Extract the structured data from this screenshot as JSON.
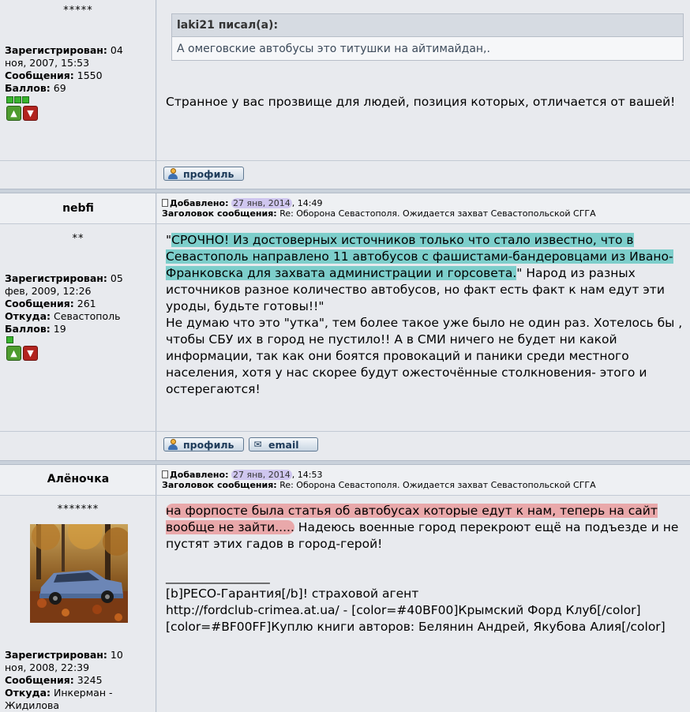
{
  "post1": {
    "stars": "*****",
    "registered_label": "Зарегистрирован:",
    "registered_value_1": "04",
    "registered_value_2": "ноя, 2007, 15:53",
    "messages_label": "Сообщения:",
    "messages_value": "1550",
    "points_label": "Баллов:",
    "points_value": "69",
    "quote_author": "laki21 писал(а):",
    "quote_text": "А омеговские автобусы это титушки на айтимайдан,.",
    "body": "Странное у вас прозвище для людей, позиция которых, отличается от вашей!",
    "profile_label": "профиль"
  },
  "post2": {
    "author": "nebfi",
    "stars": "**",
    "added_label": "Добавлено:",
    "date": "27 янв, 2014",
    "time": ", 14:49",
    "subject_label": "Заголовок сообщения:",
    "subject": "Re: Оборона Севастополя. Ожидается захват Севастопольской СГГА",
    "registered_label": "Зарегистрирован:",
    "registered_value_1": "05",
    "registered_value_2": "фев, 2009, 12:26",
    "messages_label": "Сообщения:",
    "messages_value": "261",
    "from_label": "Откуда:",
    "from_value": "Севастополь",
    "points_label": "Баллов:",
    "points_value": "19",
    "body_q_open": "\"",
    "body_highlight": "СРОЧНО! Из достоверных источников только что стало известно, что в Севастополь направлено 11 автобусов с фашистами-бандеровцами из Ивано-Франковска для захвата администрации и горсовета.",
    "body_rest": "\" Народ из разных источников разное количество автобусов, но факт есть факт к нам едут эти уроды, будьте готовы!!\"",
    "body_p2": "Не думаю что это \"утка\", тем более такое уже было не один раз. Хотелось бы , чтобы СБУ их в город не пустило!! А в СМИ ничего не будет ни какой информации, так как они боятся провокаций и паники среди местного населения, хотя у нас скорее будут ожесточённые столкновения- этого и остерегаются!",
    "profile_label": "профиль",
    "email_label": "email"
  },
  "post3": {
    "author": "Алёночка",
    "stars": "*******",
    "added_label": "Добавлено:",
    "date": "27 янв, 2014",
    "time": ", 14:53",
    "subject_label": "Заголовок сообщения:",
    "subject": "Re: Оборона Севастополя. Ожидается захват Севастопольской СГГА",
    "registered_label": "Зарегистрирован:",
    "registered_value_1": "10",
    "registered_value_2": "ноя, 2008, 22:39",
    "messages_label": "Сообщения:",
    "messages_value": "3245",
    "from_label": "Откуда:",
    "from_value": "Инкерман -",
    "from_value_2": "Жидилова",
    "body_highlight": "на форпосте была статья об автобусах которые едут к нам, теперь на сайт вообще не зайти.....",
    "body_rest": " Надеюсь военные город перекроют ещё на подъезде и не пустят этих гадов в город-герой!",
    "sig_line": "_________________",
    "sig_1": "[b]РЕСО-Гарантия[/b]! страховой агент",
    "sig_2": "http://fordclub-crimea.at.ua/ - [color=#40BF00]Крымский Форд Клуб[/color]",
    "sig_3": "[color=#BF00FF]Куплю книги авторов: Белянин Андрей, Якубова Алия[/color]"
  },
  "colors": {
    "highlight_teal": "#7dcecb",
    "highlight_pink": "#e9a8aa",
    "date_highlight": "#cfc6ef",
    "rank_green": "#38b32d"
  }
}
